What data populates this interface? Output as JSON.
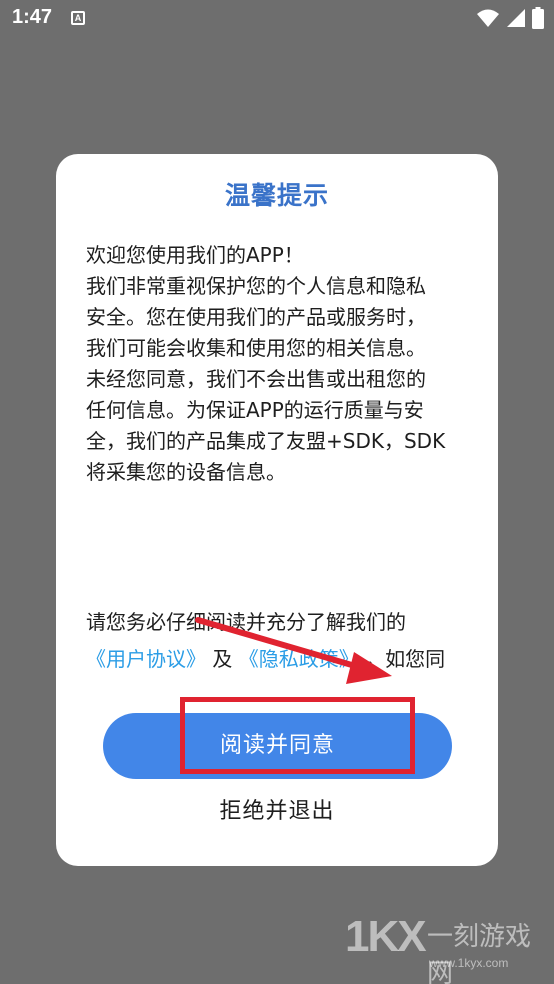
{
  "status_bar": {
    "time": "1:47",
    "notification_icon": "a-letter-icon",
    "icons": [
      "wifi-icon",
      "signal-icon",
      "battery-icon"
    ]
  },
  "dialog": {
    "title": "温馨提示",
    "body_lines": [
      "欢迎您使用我们的APP！",
      "我们非常重视保护您的个人信息和隐私",
      "安全。您在使用我们的产品或服务时，",
      "我们可能会收集和使用您的相关信息。",
      "未经您同意，我们不会出售或出租您的",
      "任何信息。为保证APP的运行质量与安",
      "全，我们的产品集成了友盟+SDK，SDK",
      "将采集您的设备信息。"
    ],
    "notice_line1": "请您务必仔细阅读并充分了解我们的",
    "user_agreement_link": "《用户协议》",
    "connector": "及",
    "privacy_policy_link": "《隐私政策》",
    "notice_tail": "，如您同",
    "agree_label": "阅读并同意",
    "reject_label": "拒绝并退出"
  },
  "watermark": {
    "logo": "1KX",
    "name": "一刻游戏网",
    "url": "www.1kyx.com"
  },
  "colors": {
    "title": "#3a73c9",
    "agree_button": "#4286e8",
    "link": "#2b9de6",
    "annotation": "#e02330",
    "overlay": "#6e6e6e"
  }
}
